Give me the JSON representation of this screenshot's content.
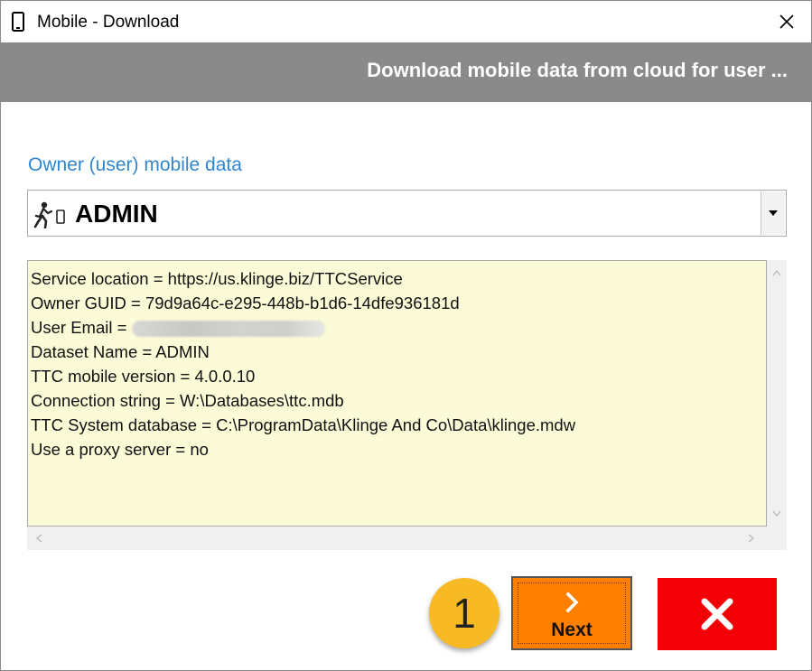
{
  "window": {
    "title": "Mobile - Download",
    "header": "Download mobile data from cloud for user ..."
  },
  "owner": {
    "label": "Owner (user) mobile data",
    "selected": "ADMIN"
  },
  "info": {
    "lines": [
      "Service location = https://us.klinge.biz/TTCService",
      "Owner GUID = 79d9a64c-e295-448b-b1d6-14dfe936181d",
      "User Email = ",
      "Dataset Name = ADMIN",
      "TTC mobile version = 4.0.0.10",
      "Connection string = W:\\Databases\\ttc.mdb",
      "TTC System database = C:\\ProgramData\\Klinge And Co\\Data\\klinge.mdw",
      "Use a proxy server = no"
    ]
  },
  "buttons": {
    "next_label": "Next",
    "badge_number": "1"
  },
  "colors": {
    "header_band": "#8a8a8a",
    "owner_label": "#2e86d1",
    "info_background": "#fcfbd8",
    "next_button": "#ff7f00",
    "cancel_button": "#f20005",
    "badge": "#f7b924"
  },
  "icons": {
    "title": "mobile-phone-icon",
    "close": "close-icon",
    "combo": "walking-person-phone-icon",
    "dropdown": "dropdown-arrow-icon",
    "next": "chevron-right-icon",
    "cancel": "x-icon"
  }
}
